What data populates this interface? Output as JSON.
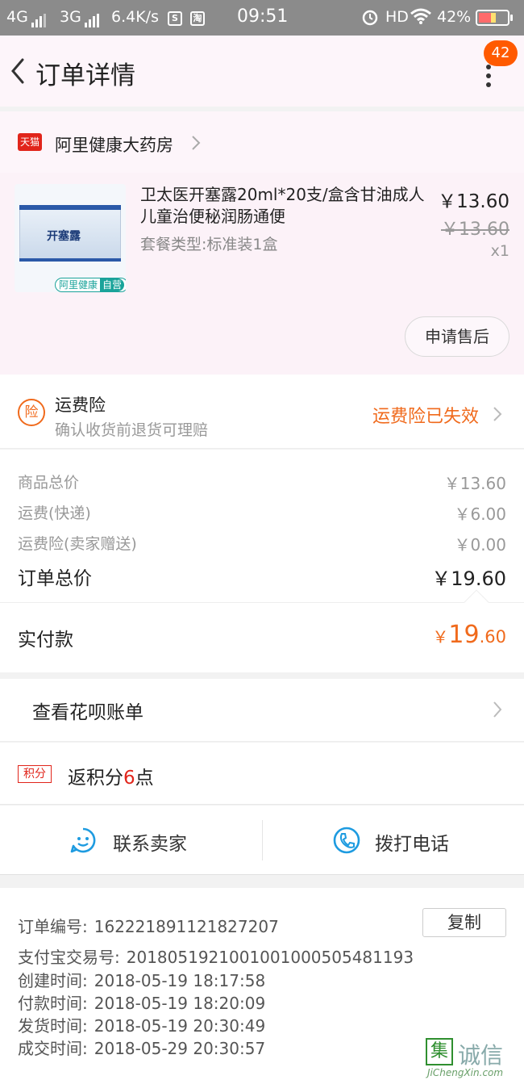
{
  "status_bar": {
    "network1": "4G",
    "network2": "3G",
    "speed": "6.4K/s",
    "time": "09:51",
    "hd": "HD",
    "battery": "42%"
  },
  "header": {
    "title": "订单详情",
    "badge_count": "42"
  },
  "shop": {
    "tmall_label": "天猫",
    "name": "阿里健康大药房"
  },
  "product": {
    "image_label": "开塞露",
    "image_tag": "阿里健康",
    "image_tag2": "自营",
    "title": "卫太医开塞露20ml*20支/盒含甘油成人儿童治便秘润肠通便",
    "spec": "套餐类型:标准装1盒",
    "price": "￥13.60",
    "original_price": "￥13.60",
    "quantity": "x1",
    "after_sale_button": "申请售后"
  },
  "insurance": {
    "icon_text": "险",
    "title": "运费险",
    "subtitle": "确认收货前退货可理赔",
    "status": "运费险已失效"
  },
  "summary": {
    "rows": [
      {
        "label": "商品总价",
        "value": "￥13.60"
      },
      {
        "label": "运费(快递)",
        "value": "￥6.00"
      },
      {
        "label": "运费险(卖家赠送)",
        "value": "￥0.00"
      }
    ],
    "total_label": "订单总价",
    "total_value": "￥19.60"
  },
  "paid": {
    "label": "实付款",
    "currency": "￥",
    "integer": "19",
    "decimal": ".60"
  },
  "huabei": {
    "label": "查看花呗账单"
  },
  "points": {
    "icon_text": "积分",
    "prefix": "返积分",
    "number": "6",
    "suffix": "点"
  },
  "contact": {
    "seller_label": "联系卖家",
    "phone_label": "拨打电话"
  },
  "order_info": {
    "copy_button": "复制",
    "rows": [
      {
        "label": "订单编号:",
        "value": "162221891121827207"
      },
      {
        "label": "支付宝交易号:",
        "value": "2018051921001001000505481193"
      },
      {
        "label": "创建时间:",
        "value": "2018-05-19 18:17:58"
      },
      {
        "label": "付款时间:",
        "value": "2018-05-19 18:20:09"
      },
      {
        "label": "发货时间:",
        "value": "2018-05-19 20:30:49"
      },
      {
        "label": "成交时间:",
        "value": "2018-05-29 20:30:57"
      }
    ]
  },
  "watermark": {
    "glyph": "集",
    "text": "诚信",
    "url": "JiChengXin.com"
  },
  "colors": {
    "accent_orange": "#f06a1c",
    "tmall_red": "#e1251b",
    "badge_orange": "#ff5a00"
  }
}
